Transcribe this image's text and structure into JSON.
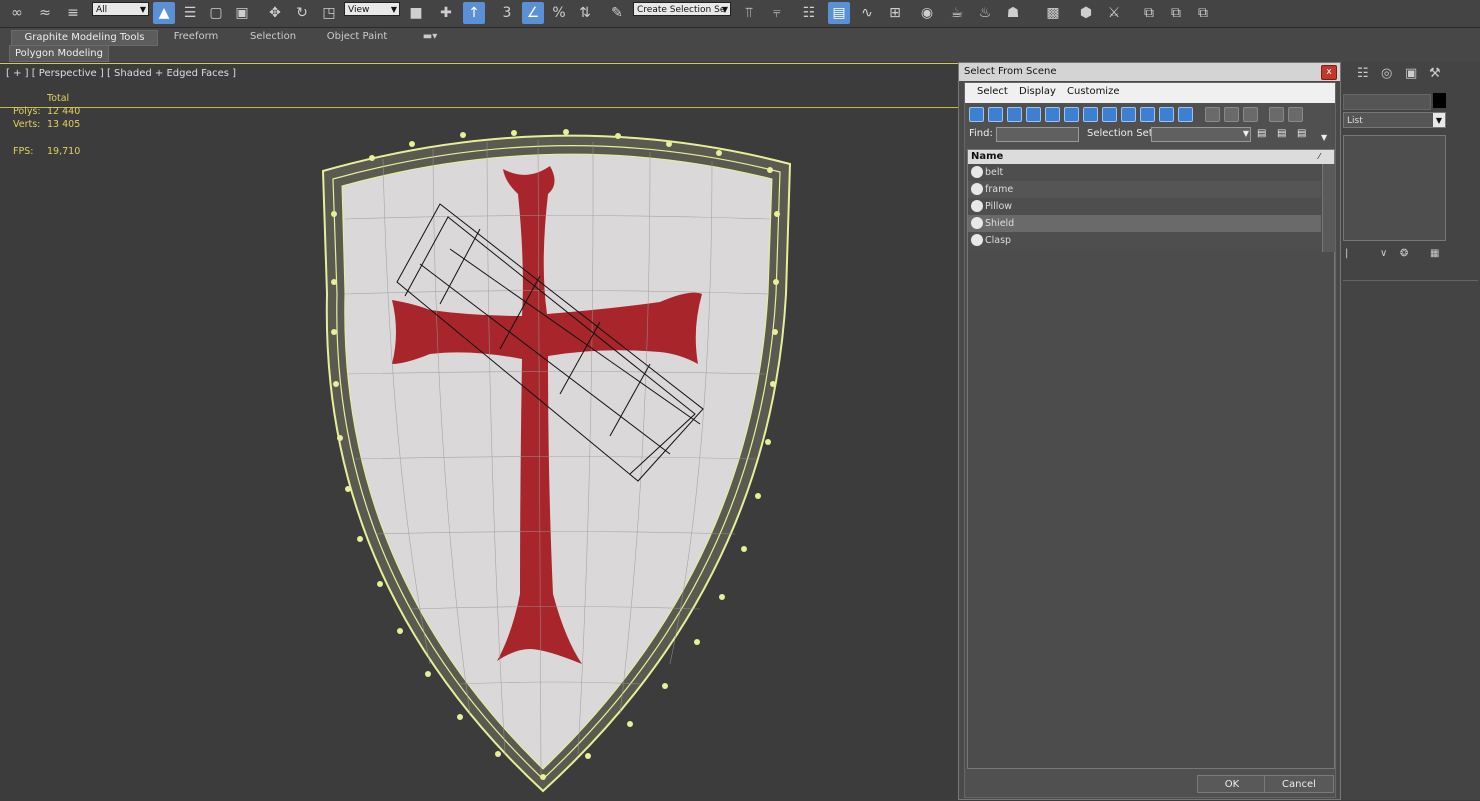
{
  "toolbar": {
    "selection_filter": "All",
    "ref_coord": "View",
    "named_selection_placeholder": "Create Selection Se"
  },
  "ribbon": {
    "tabs": [
      "Graphite Modeling Tools",
      "Freeform",
      "Selection",
      "Object Paint"
    ],
    "subtab": "Polygon Modeling"
  },
  "viewport": {
    "label": "[ + ] [ Perspective ] [ Shaded + Edged Faces ]",
    "stats": {
      "total_label": "Total",
      "polys_label": "Polys:",
      "polys_value": "12 440",
      "verts_label": "Verts:",
      "verts_value": "13 405",
      "fps_label": "FPS:",
      "fps_value": "19,710"
    }
  },
  "dialog": {
    "title": "Select From Scene",
    "close_glyph": "x",
    "menu": [
      "Select",
      "Display",
      "Customize"
    ],
    "find_label": "Find:",
    "selection_set_label": "Selection Set:",
    "column_name": "Name",
    "objects": [
      {
        "name": "belt",
        "selected": false
      },
      {
        "name": "frame",
        "selected": false
      },
      {
        "name": "Pillow",
        "selected": false
      },
      {
        "name": "Shield",
        "selected": true
      },
      {
        "name": "Clasp",
        "selected": false
      }
    ],
    "ok_label": "OK",
    "cancel_label": "Cancel"
  },
  "command_panel": {
    "list_label": "List"
  },
  "colors": {
    "cross_red": "#a8262b",
    "shield_white": "#dad8d8",
    "wire_yellow": "#e7ef9a",
    "accent_blue": "#3d7fd1"
  }
}
